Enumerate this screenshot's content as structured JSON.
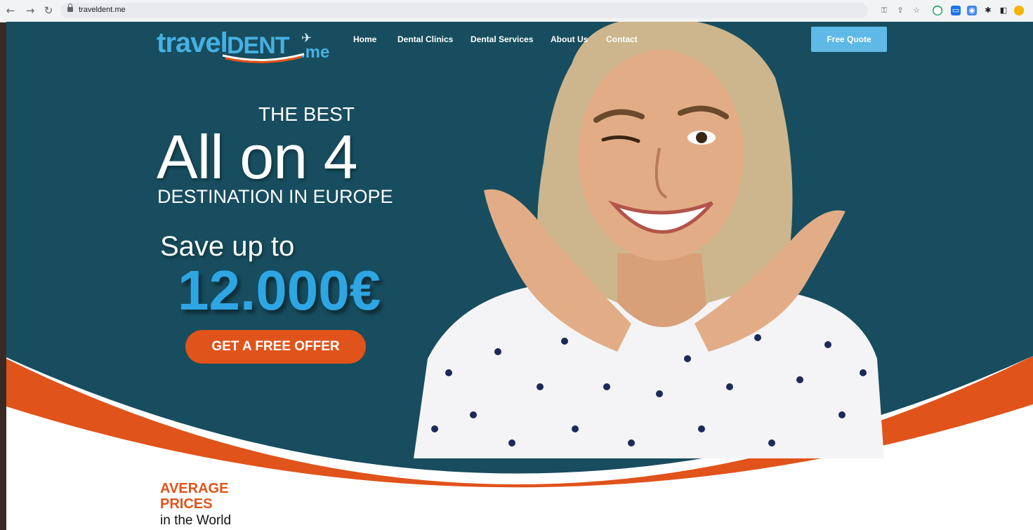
{
  "browser": {
    "url": "traveldent.me",
    "back_icon": "arrow-left-icon",
    "forward_icon": "arrow-right-icon",
    "reload_icon": "reload-icon"
  },
  "header": {
    "logo": {
      "part1": "travel",
      "part2": "DENT",
      "part3": ".me"
    },
    "menu": [
      "Home",
      "Dental Clinics",
      "Dental Services",
      "About Us",
      "Contact"
    ],
    "cta": "Free Quote"
  },
  "hero": {
    "kicker": "THE BEST",
    "headline": "All on 4",
    "sub": "DESTINATION IN EUROPE",
    "save_label": "Save up to",
    "amount": "12.000€",
    "button": "GET A FREE OFFER"
  },
  "section": {
    "line1": "AVERAGE",
    "line2": "PRICES",
    "line3": "in the World"
  },
  "colors": {
    "hero_bg": "#174d5e",
    "accent_orange": "#e0531b",
    "accent_blue": "#2ea6e3",
    "quote_button": "#5fb9e6"
  }
}
